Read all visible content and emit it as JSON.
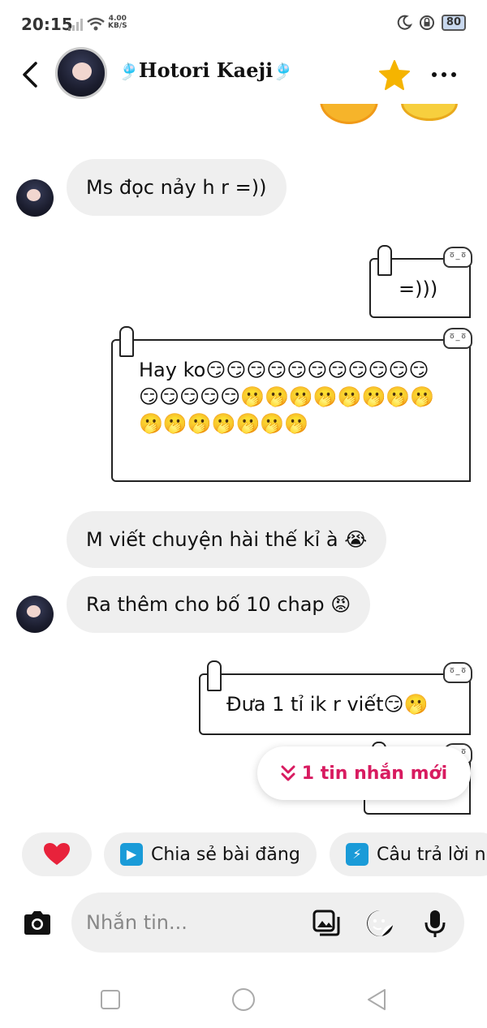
{
  "status_bar": {
    "time": "20:15",
    "net_speed_value": "4.00",
    "net_speed_unit": "KB/S",
    "battery": "80"
  },
  "header": {
    "contact_name": "Hotori Kaeji",
    "name_decoration": "🎐"
  },
  "messages": [
    {
      "id": "m1",
      "from": "them",
      "text": "Ms đọc nảy h r =))"
    },
    {
      "id": "m2",
      "from": "me",
      "text": "=)))"
    },
    {
      "id": "m3",
      "from": "me",
      "text": "Hay ko😏😏😏😏😏😏😏😏😏😏😏😏😏😏😏😏🫢🫢🫢🫢🫢🫢🫢🫢🫢🫢🫢🫢🫢🫢🫢"
    },
    {
      "id": "m4",
      "from": "them",
      "text": "M viết chuyện hài thế kỉ à 😭"
    },
    {
      "id": "m5",
      "from": "them",
      "text": "Ra thêm cho bố 10 chap 😡"
    },
    {
      "id": "m6",
      "from": "me",
      "text": "Đưa 1 tỉ ik r viết😏🫢"
    }
  ],
  "new_messages_banner": {
    "label": "1 tin nhắn mới"
  },
  "quick_actions": [
    {
      "id": "heart",
      "label": "",
      "icon": "heart-icon"
    },
    {
      "id": "share_post",
      "label": "Chia sẻ bài đăng",
      "icon": "play-icon"
    },
    {
      "id": "quick_reply",
      "label": "Câu trả lời n",
      "icon": "lightning-icon"
    }
  ],
  "composer": {
    "placeholder": "Nhắn tin..."
  },
  "colors": {
    "accent": "#d81b60",
    "bubble_incoming": "#efefef",
    "star": "#f5b400"
  }
}
